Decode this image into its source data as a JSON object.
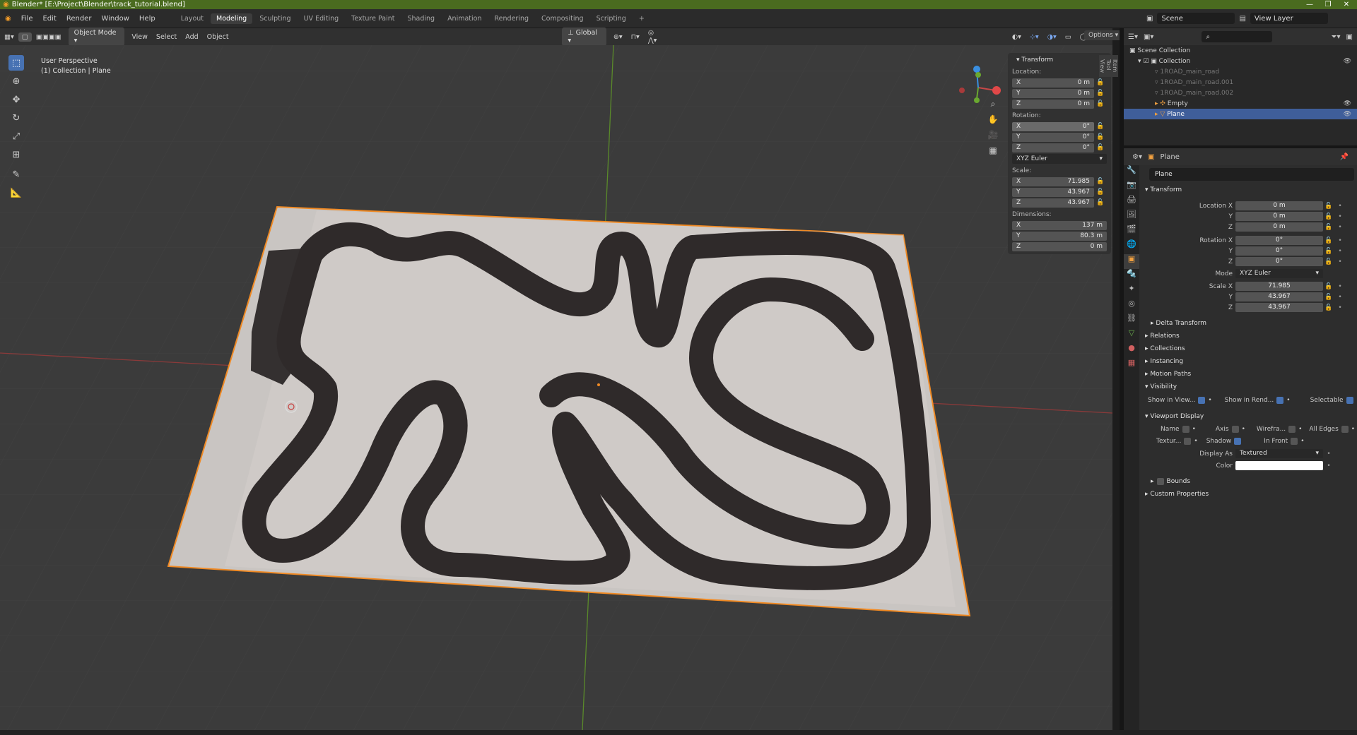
{
  "window": {
    "title": "Blender* [E:\\Project\\Blender\\track_tutorial.blend]"
  },
  "menu": {
    "items": [
      "File",
      "Edit",
      "Render",
      "Window",
      "Help"
    ]
  },
  "workspaces": {
    "tabs": [
      "Layout",
      "Modeling",
      "Sculpting",
      "UV Editing",
      "Texture Paint",
      "Shading",
      "Animation",
      "Rendering",
      "Compositing",
      "Scripting"
    ],
    "active": "Modeling"
  },
  "top_right": {
    "scene": "Scene",
    "view_layer": "View Layer"
  },
  "header": {
    "mode": "Object Mode",
    "menus": [
      "View",
      "Select",
      "Add",
      "Object"
    ],
    "orientation": "Global",
    "options": "Options"
  },
  "viewport": {
    "perspective": "User Perspective",
    "collection": "(1) Collection | Plane"
  },
  "npanel": {
    "title": "Transform",
    "location_label": "Location:",
    "location": [
      {
        "axis": "X",
        "value": "0 m"
      },
      {
        "axis": "Y",
        "value": "0 m"
      },
      {
        "axis": "Z",
        "value": "0 m"
      }
    ],
    "rotation_label": "Rotation:",
    "rotation": [
      {
        "axis": "X",
        "value": "0°"
      },
      {
        "axis": "Y",
        "value": "0°"
      },
      {
        "axis": "Z",
        "value": "0°"
      }
    ],
    "rotation_mode": "XYZ Euler",
    "scale_label": "Scale:",
    "scale": [
      {
        "axis": "X",
        "value": "71.985"
      },
      {
        "axis": "Y",
        "value": "43.967"
      },
      {
        "axis": "Z",
        "value": "43.967"
      }
    ],
    "dimensions_label": "Dimensions:",
    "dimensions": [
      {
        "axis": "X",
        "value": "137 m"
      },
      {
        "axis": "Y",
        "value": "80.3 m"
      },
      {
        "axis": "Z",
        "value": "0 m"
      }
    ],
    "tabs": [
      "Item",
      "Tool",
      "View"
    ]
  },
  "outliner": {
    "root": "Scene Collection",
    "collection": "Collection",
    "items": [
      {
        "name": "1ROAD_main_road",
        "dim": true
      },
      {
        "name": "1ROAD_main_road.001",
        "dim": true
      },
      {
        "name": "1ROAD_main_road.002",
        "dim": true
      },
      {
        "name": "Empty",
        "dim": false
      },
      {
        "name": "Plane",
        "dim": false
      }
    ]
  },
  "properties": {
    "object": "Plane",
    "object_field": "Plane",
    "transform_title": "Transform",
    "location": [
      {
        "label": "Location X",
        "value": "0 m"
      },
      {
        "label": "Y",
        "value": "0 m"
      },
      {
        "label": "Z",
        "value": "0 m"
      }
    ],
    "rotation": [
      {
        "label": "Rotation X",
        "value": "0°"
      },
      {
        "label": "Y",
        "value": "0°"
      },
      {
        "label": "Z",
        "value": "0°"
      }
    ],
    "mode_label": "Mode",
    "mode": "XYZ Euler",
    "scale": [
      {
        "label": "Scale X",
        "value": "71.985"
      },
      {
        "label": "Y",
        "value": "43.967"
      },
      {
        "label": "Z",
        "value": "43.967"
      }
    ],
    "delta": "Delta Transform",
    "sections": [
      "Relations",
      "Collections",
      "Instancing",
      "Motion Paths"
    ],
    "visibility": {
      "title": "Visibility",
      "show_viewport": "Show in View...",
      "show_render": "Show in Rend...",
      "selectable": "Selectable"
    },
    "viewport_display": {
      "title": "Viewport Display",
      "name": "Name",
      "axis": "Axis",
      "wireframe": "Wirefra...",
      "all_edges": "All Edges",
      "texture": "Textur...",
      "shadow": "Shadow",
      "in_front": "In Front",
      "display_as_label": "Display As",
      "display_as": "Textured",
      "color_label": "Color",
      "bounds": "Bounds"
    },
    "custom": "Custom Properties"
  },
  "colors": {
    "accent": "#4772b3",
    "selection_orange": "#f08a24",
    "titlebar": "#4a6b1f"
  }
}
